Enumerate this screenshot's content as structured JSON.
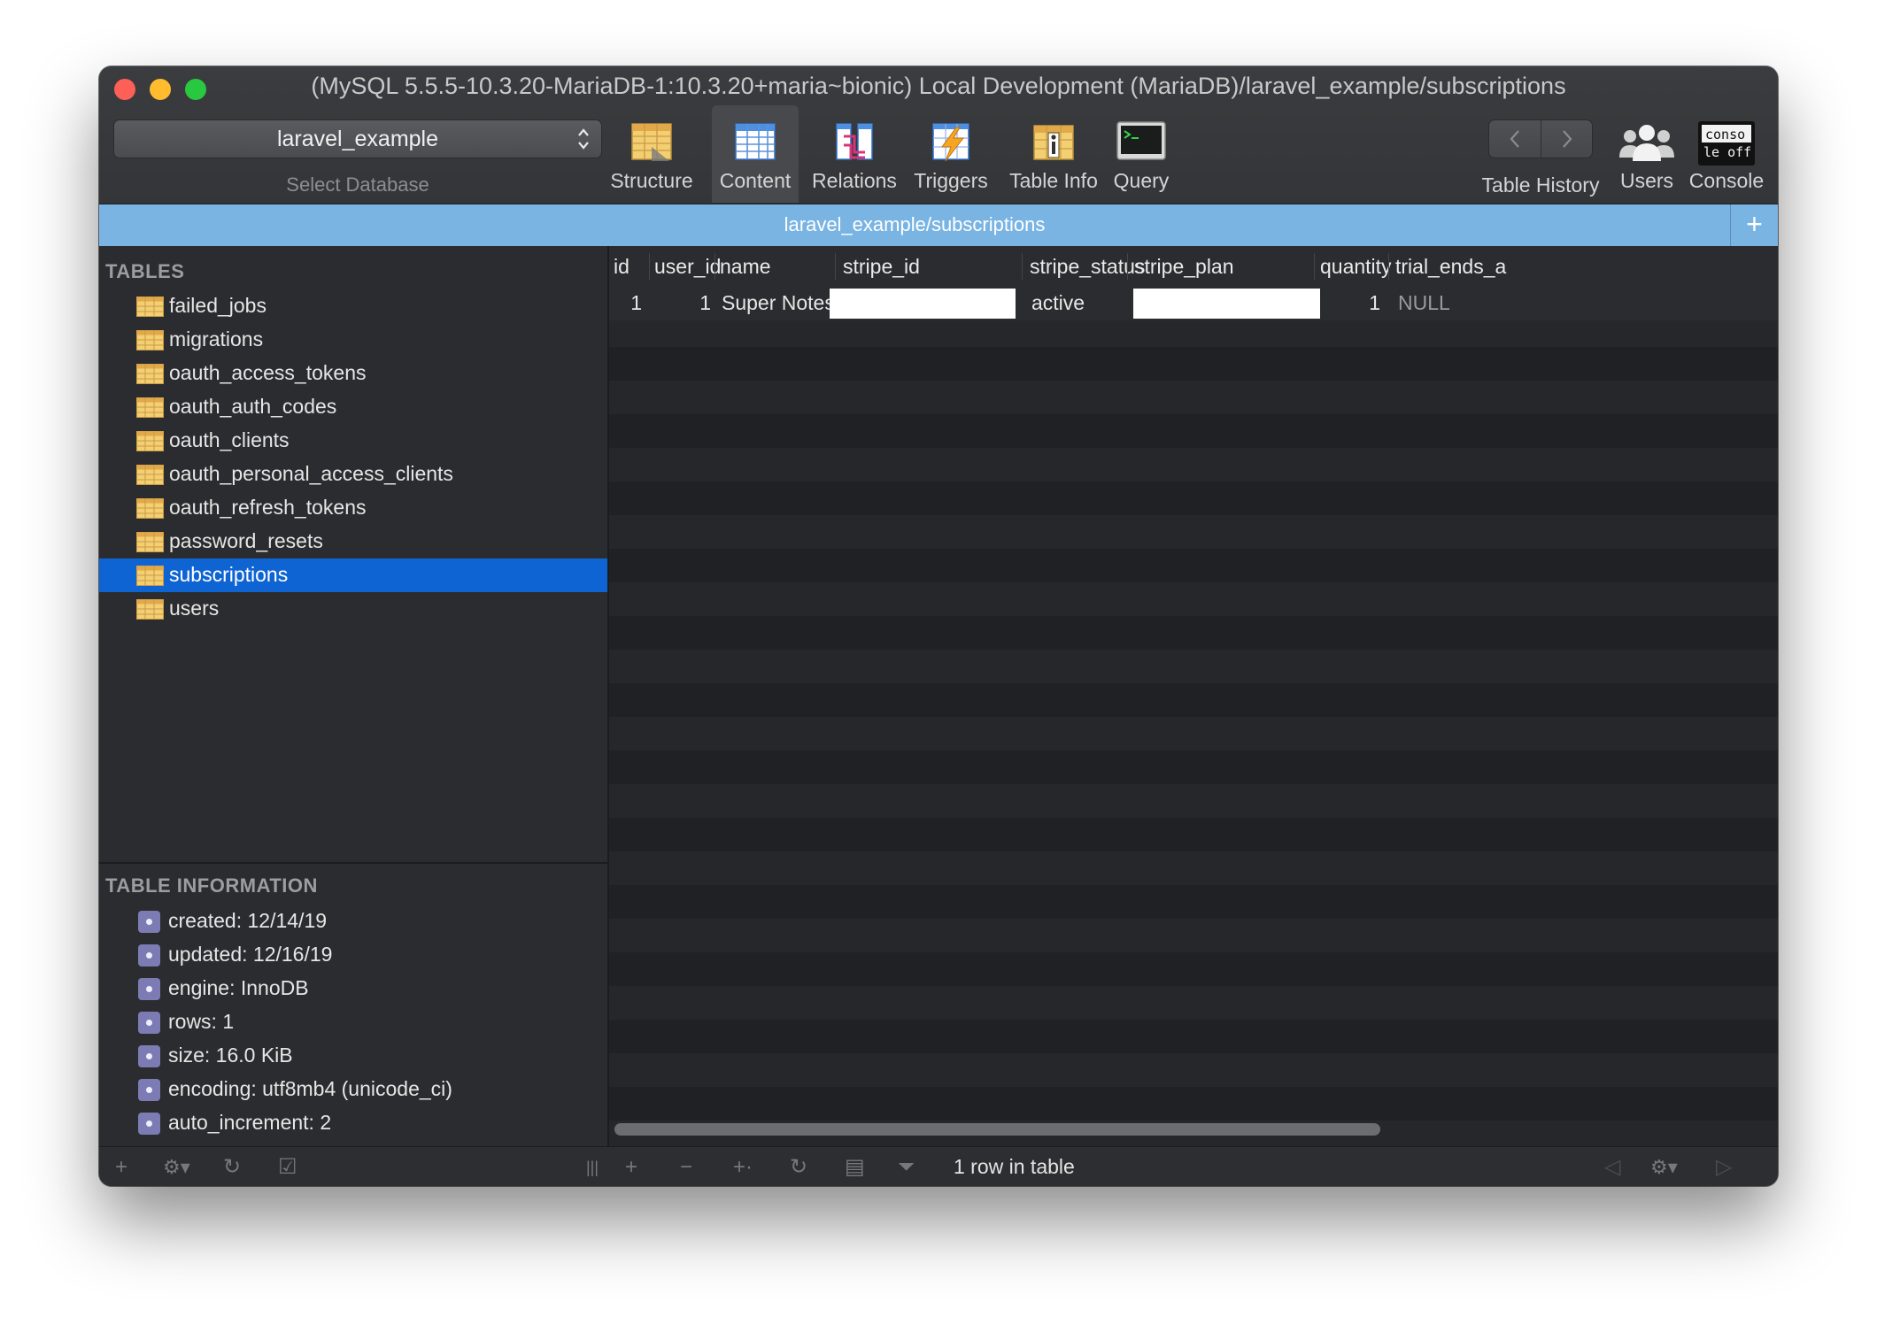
{
  "window": {
    "title": "(MySQL 5.5.5-10.3.20-MariaDB-1:10.3.20+maria~bionic) Local Development (MariaDB)/laravel_example/subscriptions"
  },
  "toolbar": {
    "database_select": {
      "value": "laravel_example",
      "caption": "Select Database"
    },
    "tools": [
      {
        "label": "Structure",
        "icon": "structure-icon"
      },
      {
        "label": "Content",
        "icon": "content-icon",
        "active": true
      },
      {
        "label": "Relations",
        "icon": "relations-icon"
      },
      {
        "label": "Triggers",
        "icon": "triggers-icon"
      },
      {
        "label": "Table Info",
        "icon": "table-info-icon"
      },
      {
        "label": "Query",
        "icon": "query-icon"
      }
    ],
    "table_history_label": "Table History",
    "users_label": "Users",
    "console_label": "Console",
    "console_icon_text": [
      "conso",
      "le off"
    ]
  },
  "tabbar": {
    "title": "laravel_example/subscriptions",
    "add_label": "+"
  },
  "sidebar": {
    "tables_heading": "TABLES",
    "tables": [
      "failed_jobs",
      "migrations",
      "oauth_access_tokens",
      "oauth_auth_codes",
      "oauth_clients",
      "oauth_personal_access_clients",
      "oauth_refresh_tokens",
      "password_resets",
      "subscriptions",
      "users"
    ],
    "selected_table": "subscriptions",
    "info_heading": "TABLE INFORMATION",
    "info": [
      "created: 12/14/19",
      "updated: 12/16/19",
      "engine: InnoDB",
      "rows: 1",
      "size: 16.0 KiB",
      "encoding: utf8mb4 (unicode_ci)",
      "auto_increment: 2"
    ]
  },
  "grid": {
    "columns": [
      "id",
      "user_id",
      "name",
      "stripe_id",
      "stripe_status",
      "stripe_plan",
      "quantity",
      "trial_ends_a"
    ],
    "rows": [
      {
        "id": "1",
        "user_id": "1",
        "name": "Super Notes",
        "stripe_id": "",
        "stripe_status": "active",
        "stripe_plan": "",
        "quantity": "1",
        "trial_ends_at": "NULL"
      }
    ]
  },
  "status": {
    "row_count": "1 row in table"
  },
  "colors": {
    "selection": "#0f64d3",
    "tabbar": "#79b4e3",
    "window_bg": "#2a2b2e"
  }
}
